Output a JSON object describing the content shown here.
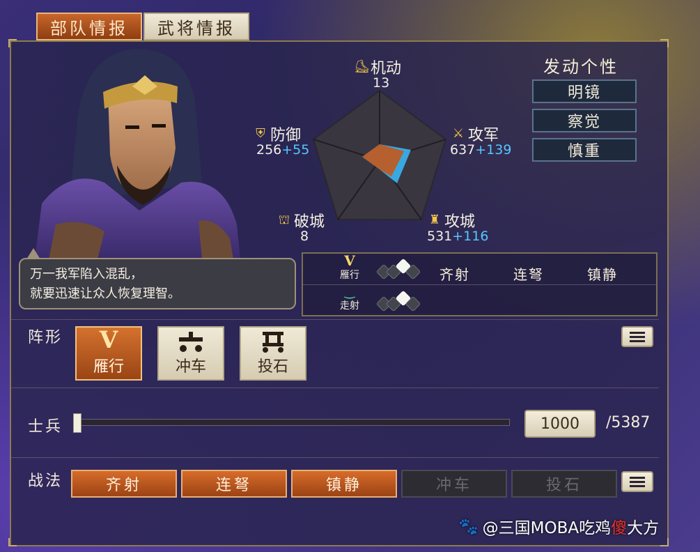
{
  "tabs": [
    {
      "label": "部队情报",
      "active": true
    },
    {
      "label": "武将情报",
      "active": false
    }
  ],
  "dialogue": {
    "line1": "万一我军陷入混乱，",
    "line2": "就要迅速让众人恢复理智。"
  },
  "stats": {
    "mobility": {
      "label": "机动",
      "icon": "boot-icon",
      "base": "13",
      "bonus": ""
    },
    "defense": {
      "label": "防御",
      "icon": "shield-icon",
      "base": "256",
      "bonus": "+55"
    },
    "attack": {
      "label": "攻军",
      "icon": "sword-icon",
      "base": "637",
      "bonus": "+139"
    },
    "siege": {
      "label": "攻城",
      "icon": "castle-icon",
      "base": "531",
      "bonus": "+116"
    },
    "break": {
      "label": "破城",
      "icon": "fort-icon",
      "base": "8",
      "bonus": ""
    }
  },
  "personality": {
    "title": "发动个性",
    "items": [
      "明镜",
      "察觉",
      "慎重"
    ]
  },
  "formation_skills": {
    "rows": [
      {
        "formation": "雁行",
        "glyph": "V",
        "skills": [
          "齐射",
          "连弩",
          "镇静"
        ]
      },
      {
        "formation": "走射",
        "glyph": "‿",
        "skills": []
      }
    ]
  },
  "formation": {
    "label": "阵形",
    "options": [
      {
        "name": "雁行",
        "glyph": "V",
        "active": true
      },
      {
        "name": "冲车",
        "glyph": "车",
        "active": false
      },
      {
        "name": "投石",
        "glyph": "石",
        "active": false
      }
    ]
  },
  "troops": {
    "label": "士兵",
    "value": "1000",
    "max": "/5387"
  },
  "tactics": {
    "label": "战法",
    "items": [
      {
        "name": "齐射",
        "enabled": true
      },
      {
        "name": "连弩",
        "enabled": true
      },
      {
        "name": "镇静",
        "enabled": true
      },
      {
        "name": "冲车",
        "enabled": false
      },
      {
        "name": "投石",
        "enabled": false
      }
    ]
  },
  "watermark": {
    "prefix": "@三国MOBA吃鸡",
    "accent": "傻",
    "suffix": "大方"
  },
  "colors": {
    "accent_orange": "#c8662a",
    "bonus_blue": "#56c7ff",
    "stat_fill_brown": "#b5602e",
    "stat_fill_blue": "#3aa8e0"
  }
}
